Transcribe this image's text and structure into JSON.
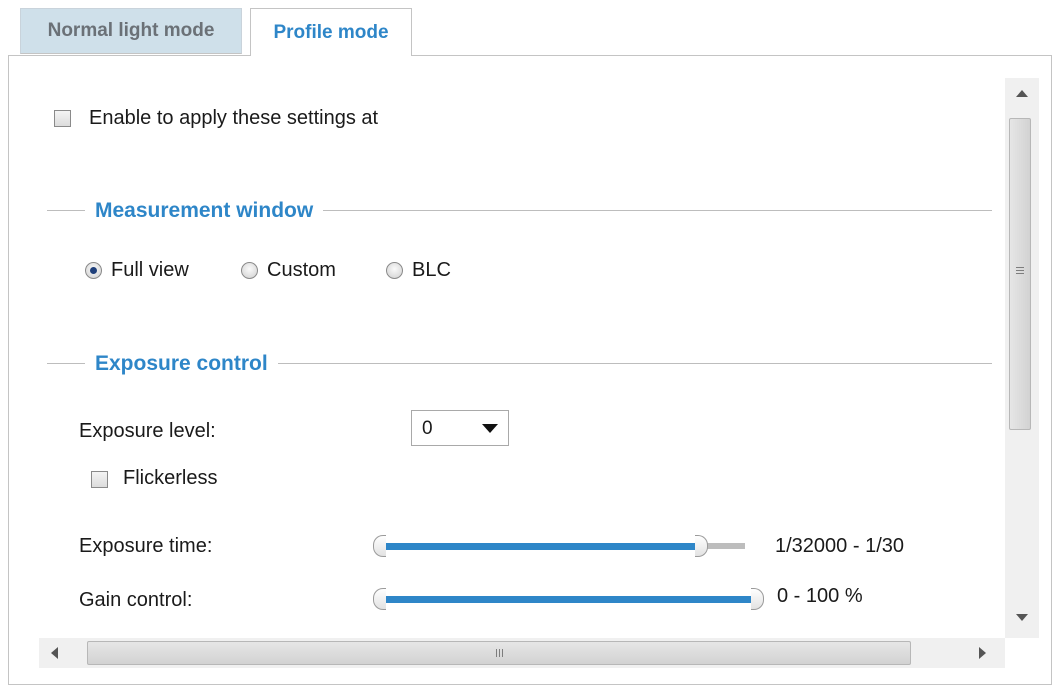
{
  "tabs": [
    {
      "label": "Normal light mode",
      "active": false
    },
    {
      "label": "Profile mode",
      "active": true
    }
  ],
  "enable": {
    "label": "Enable to apply these settings at",
    "checked": false
  },
  "measurement": {
    "title": "Measurement window",
    "options": [
      {
        "label": "Full view",
        "selected": true
      },
      {
        "label": "Custom",
        "selected": false
      },
      {
        "label": "BLC",
        "selected": false
      }
    ]
  },
  "exposure": {
    "title": "Exposure control",
    "level_label": "Exposure level:",
    "level_value": "0",
    "flickerless_label": "Flickerless",
    "flickerless_checked": false,
    "time_label": "Exposure time:",
    "time_range": "1/32000 - 1/30",
    "gain_label": "Gain control:",
    "gain_range": "0 - 100 %"
  },
  "colors": {
    "accent": "#2e86c8",
    "tab_inactive_bg": "#cfe0ea"
  }
}
